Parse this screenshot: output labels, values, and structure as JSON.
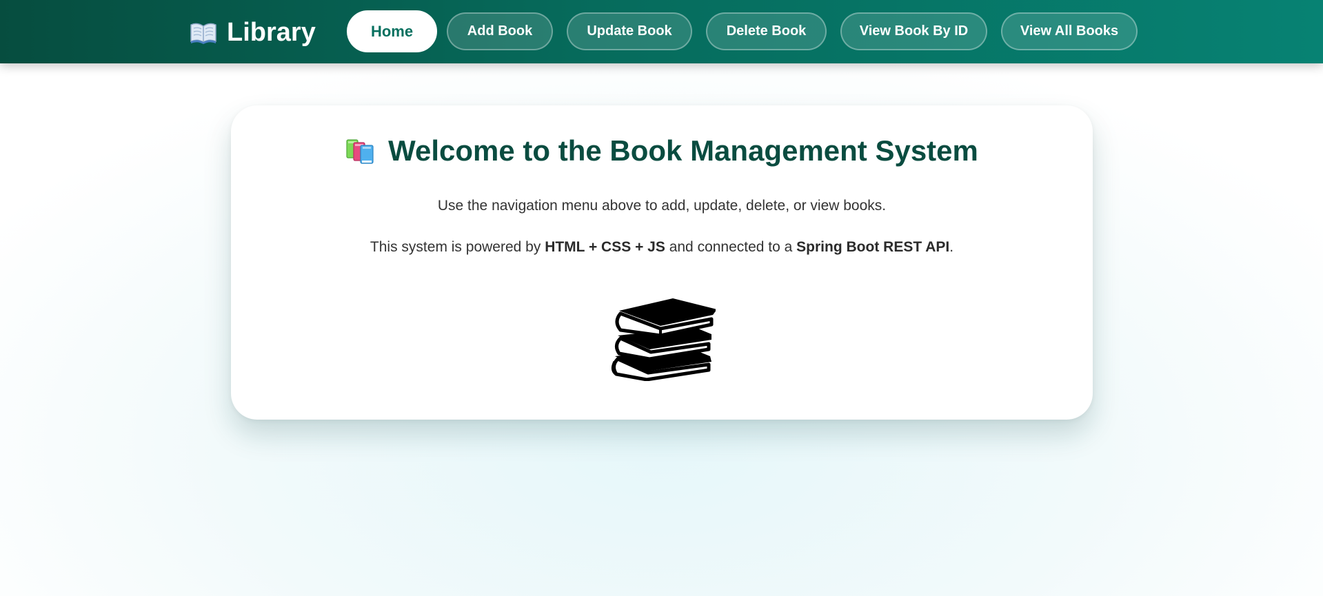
{
  "navbar": {
    "brand": {
      "icon": "open-book-icon",
      "label": "Library"
    },
    "items": [
      {
        "label": "Home",
        "active": true
      },
      {
        "label": "Add Book",
        "active": false
      },
      {
        "label": "Update Book",
        "active": false
      },
      {
        "label": "Delete Book",
        "active": false
      },
      {
        "label": "View Book By ID",
        "active": false
      },
      {
        "label": "View All Books",
        "active": false
      }
    ]
  },
  "main": {
    "title_icon": "books-icon",
    "title": "Welcome to the Book Management System",
    "line1": "Use the navigation menu above to add, update, delete, or view books.",
    "line2": {
      "prefix": "This system is powered by ",
      "bold1": "HTML + CSS + JS",
      "middle": " and connected to a ",
      "bold2": "Spring Boot REST API",
      "suffix": "."
    },
    "illustration": "book-stack-icon"
  },
  "colors": {
    "nav_dark": "#064d3f",
    "nav_light": "#078273",
    "title": "#0a4c40",
    "active_text": "#07705f"
  }
}
